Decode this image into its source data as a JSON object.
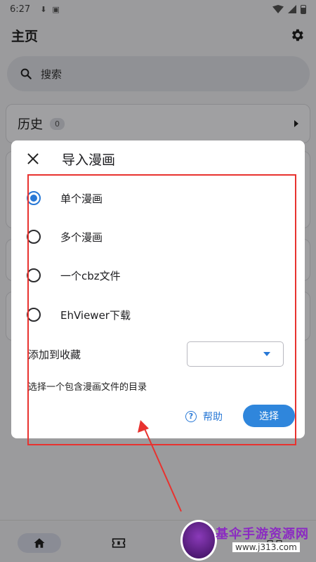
{
  "status_bar": {
    "time": "6:27"
  },
  "app_bar": {
    "title": "主页"
  },
  "search": {
    "placeholder": "搜索"
  },
  "history": {
    "label": "历史",
    "count": "0"
  },
  "bottom_nav": {
    "more_label": "ㅁㅁ"
  },
  "dialog": {
    "title": "导入漫画",
    "options": [
      {
        "label": "单个漫画",
        "selected": true
      },
      {
        "label": "多个漫画",
        "selected": false
      },
      {
        "label": "一个cbz文件",
        "selected": false
      },
      {
        "label": "EhViewer下载",
        "selected": false
      }
    ],
    "favorite_label": "添加到收藏",
    "favorite_value": "",
    "hint": "选择一个包含漫画文件的目录",
    "help_label": "帮助",
    "confirm_label": "选择"
  },
  "watermark": {
    "title": "基伞手游资源网",
    "url": "www.j313.com"
  },
  "colors": {
    "accent": "#2878d6",
    "annotation": "#e8322f"
  }
}
